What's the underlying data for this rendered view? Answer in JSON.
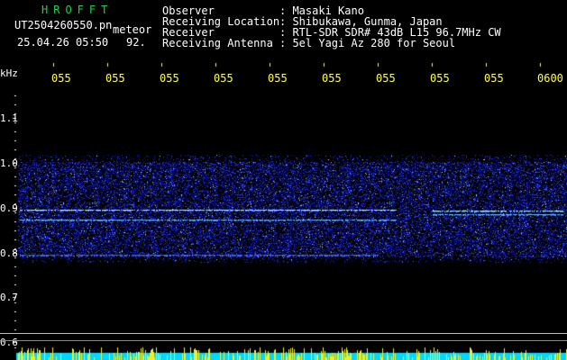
{
  "header": {
    "program_name": "HROFFT",
    "filename": "UT2504260550.pn",
    "meteor_label": "meteor",
    "datetime": "25.04.26 05:50",
    "count": "92.",
    "observer_label": "Observer",
    "observer_value": ": Masaki Kano",
    "location_label": "Receiving Location",
    "location_value": ": Shibukawa, Gunma, Japan",
    "receiver_label": "Receiver",
    "receiver_value": ": RTL-SDR SDR# 43dB L15 96.7MHz CW",
    "antenna_label": "Receiving Antenna",
    "antenna_value": ": 5el Yagi Az 280 for Seoul"
  },
  "axis": {
    "unit": "kHz",
    "y_ticks": [
      "1.1",
      "1.0",
      "0.9",
      "0.8",
      "0.7",
      "0.6"
    ],
    "x_ticks": [
      "055",
      "055",
      "055",
      "055",
      "055",
      "055",
      "055",
      "055",
      "055",
      "0600"
    ]
  },
  "colors": {
    "background": "#000000",
    "noise": "#1a2cff",
    "signal": "#7fe0ff",
    "bottom_band": "#00d8ff",
    "bottom_spikes": "#f0f020"
  }
}
